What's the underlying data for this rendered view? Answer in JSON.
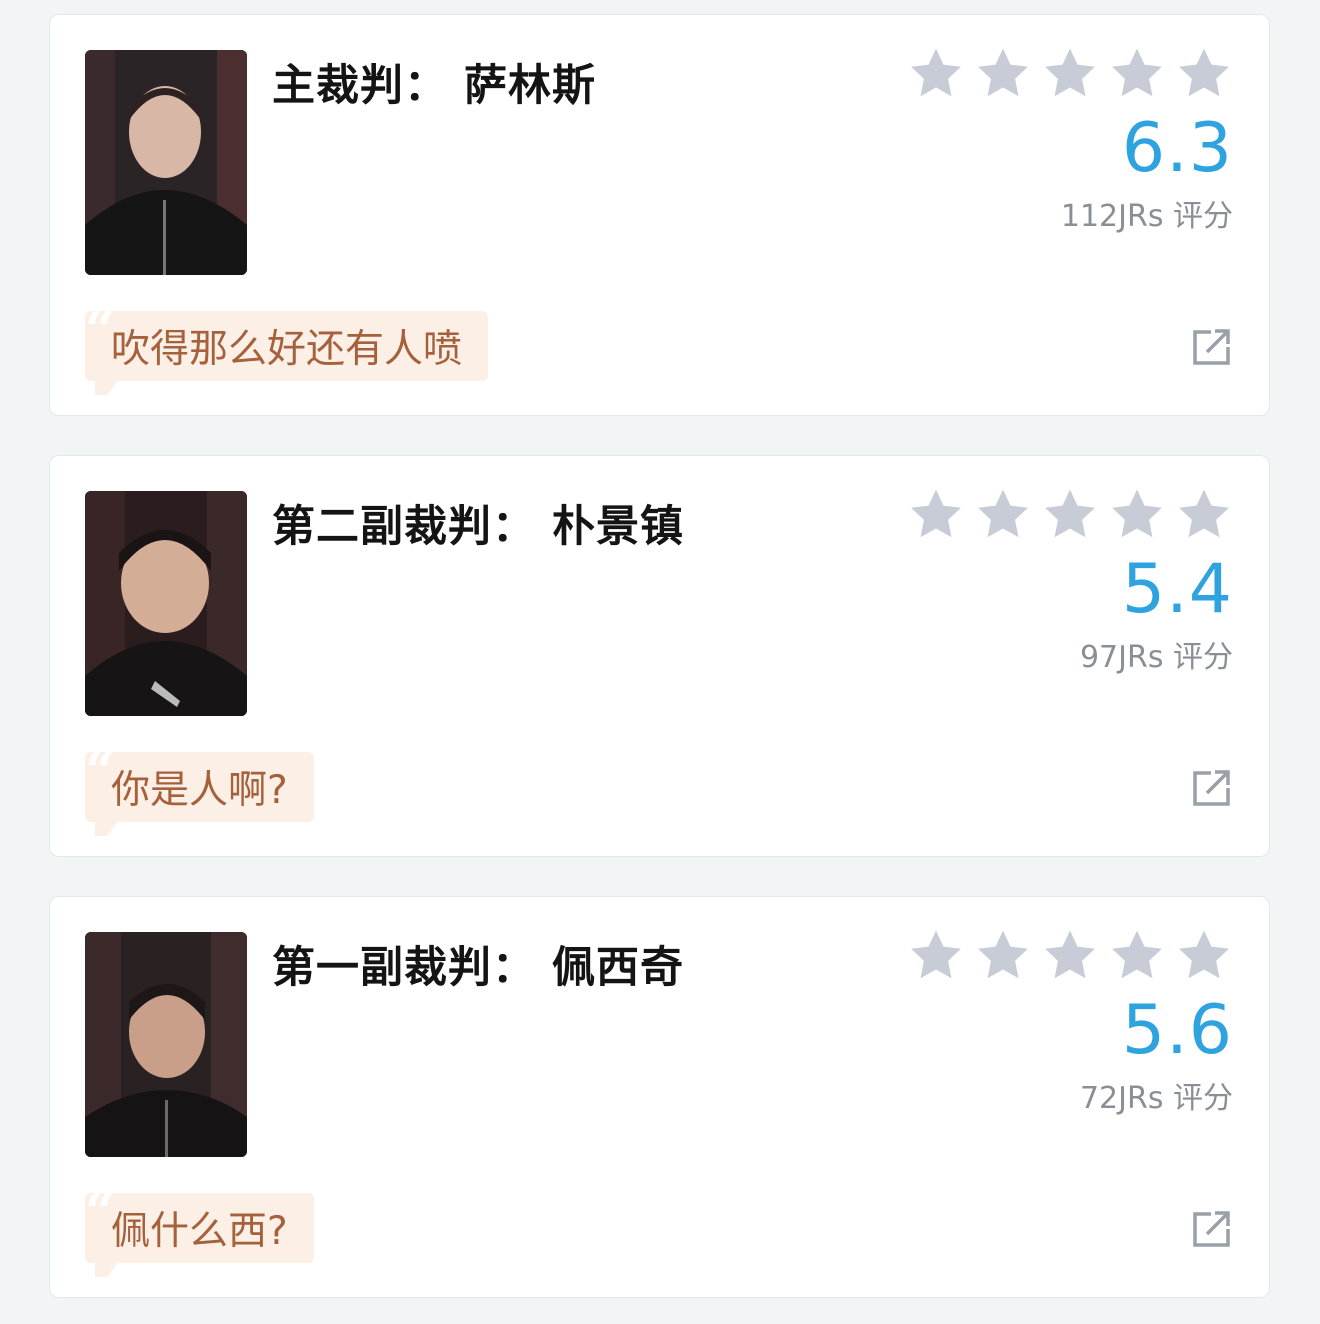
{
  "colors": {
    "background": "#f1f5f6",
    "card": "#ffffff",
    "score": "#2ea3e0",
    "star_empty": "#c7ccd6",
    "quote_bg": "#fcefe6",
    "quote_text": "#a5613c",
    "raters_text": "#8a8f96"
  },
  "referees": [
    {
      "name": "主裁判：  萨林斯",
      "score": "6.3",
      "raters": "112JRs 评分",
      "comment": "吹得那么好还有人喷",
      "stars_filled": 0,
      "stars_total": 5,
      "photo_icon": "referee-portrait"
    },
    {
      "name": "第二副裁判：  朴景镇",
      "score": "5.4",
      "raters": "97JRs 评分",
      "comment": "你是人啊?",
      "stars_filled": 0,
      "stars_total": 5,
      "photo_icon": "referee-portrait"
    },
    {
      "name": "第一副裁判：  佩西奇",
      "score": "5.6",
      "raters": "72JRs 评分",
      "comment": "佩什么西?",
      "stars_filled": 0,
      "stars_total": 5,
      "photo_icon": "referee-portrait"
    }
  ],
  "icons": {
    "star": "star-icon",
    "share": "share-icon",
    "quote": "quote-mark-icon"
  }
}
